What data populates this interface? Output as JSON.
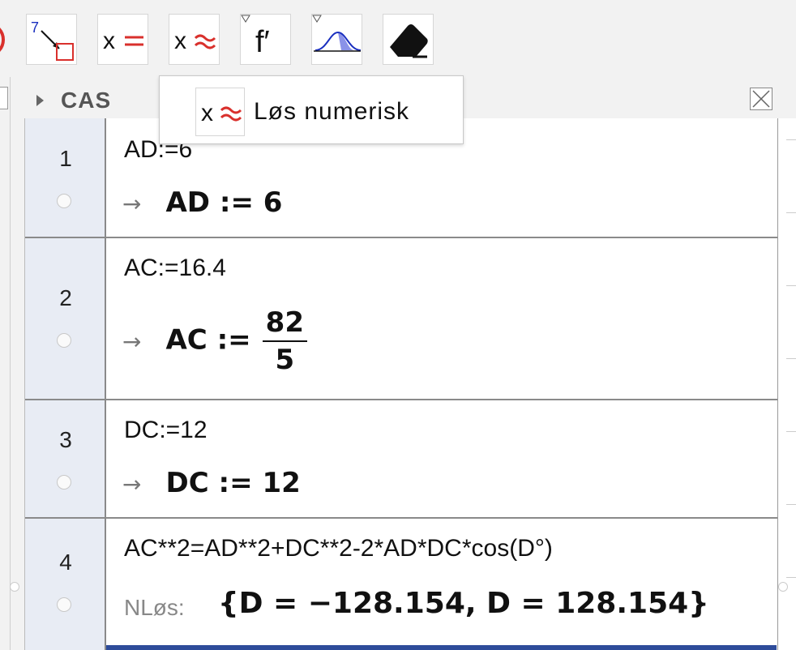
{
  "toolbar": {
    "tools": [
      {
        "name": "relation-tool",
        "icon": "relation-icon"
      },
      {
        "name": "slope-tool",
        "icon": "slope-icon",
        "label": "7"
      },
      {
        "name": "solve-tool",
        "icon": "x-equals-icon",
        "label": "x"
      },
      {
        "name": "solve-numerically-tool",
        "icon": "x-approx-icon",
        "label": "x"
      },
      {
        "name": "derivative-tool",
        "icon": "derivative-icon",
        "label": "f′"
      },
      {
        "name": "probability-tool",
        "icon": "normal-distribution-icon"
      },
      {
        "name": "delete-tool",
        "icon": "eraser-icon"
      }
    ]
  },
  "popup": {
    "icon_label": "x",
    "label": "Løs numerisk"
  },
  "cas": {
    "title": "CAS",
    "rows": [
      {
        "num": "1",
        "input": "AD:=6",
        "output_lhs": "AD",
        "output_op": ":=",
        "output_rhs": "6"
      },
      {
        "num": "2",
        "input": "AC:=16.4",
        "output_lhs": "AC",
        "output_op": ":=",
        "frac_num": "82",
        "frac_den": "5"
      },
      {
        "num": "3",
        "input": "DC:=12",
        "output_lhs": "DC",
        "output_op": ":=",
        "output_rhs": "12"
      },
      {
        "num": "4",
        "input": "AC**2=AD**2+DC**2-2*AD*DC*cos(D°)",
        "nlos_label": "NLøs:",
        "nlos_output": "{D = −128.154, D = 128.154}"
      }
    ],
    "arrow": "→"
  },
  "colors": {
    "accent_red": "#d9302c",
    "row_number_bg": "#e8ecf4",
    "active_border": "#2e4c9a"
  }
}
